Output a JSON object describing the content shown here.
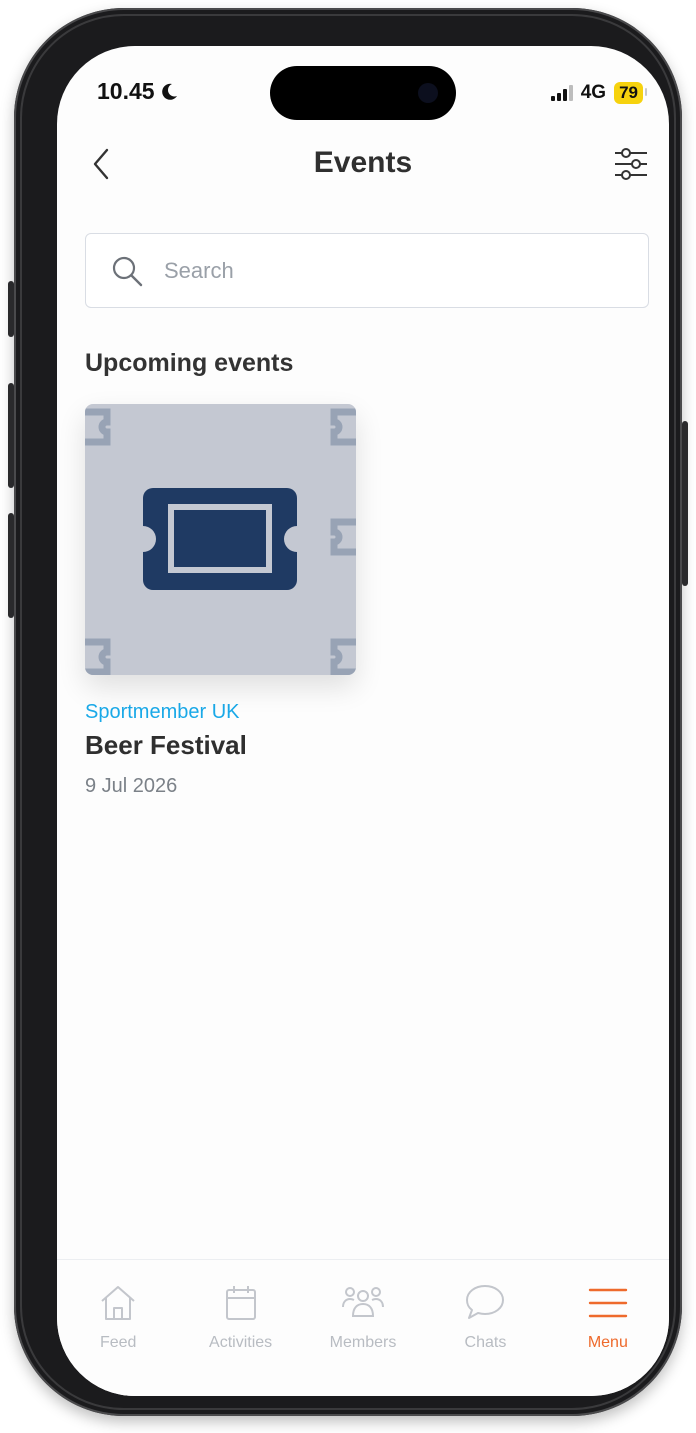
{
  "status_bar": {
    "time": "10.45",
    "network": "4G",
    "battery": "79"
  },
  "header": {
    "title": "Events"
  },
  "search": {
    "placeholder": "Search"
  },
  "upcoming": {
    "heading": "Upcoming events",
    "events": [
      {
        "organizer": "Sportmember UK",
        "name": "Beer Festival",
        "date": "9 Jul 2026",
        "thumbnail_icon": "ticket-icon"
      }
    ]
  },
  "tab_bar": {
    "tabs": [
      {
        "label": "Feed",
        "icon": "home-icon",
        "active": false
      },
      {
        "label": "Activities",
        "icon": "calendar-icon",
        "active": false
      },
      {
        "label": "Members",
        "icon": "members-icon",
        "active": false
      },
      {
        "label": "Chats",
        "icon": "chat-bubble-icon",
        "active": false
      },
      {
        "label": "Menu",
        "icon": "menu-icon",
        "active": true
      }
    ]
  },
  "colors": {
    "accent_orange": "#ee6a2c",
    "organizer_blue": "#1aa9e8",
    "ticket_navy": "#1f3a63",
    "thumbnail_bg": "#c4c8d2",
    "battery_yellow": "#f6d20e"
  }
}
